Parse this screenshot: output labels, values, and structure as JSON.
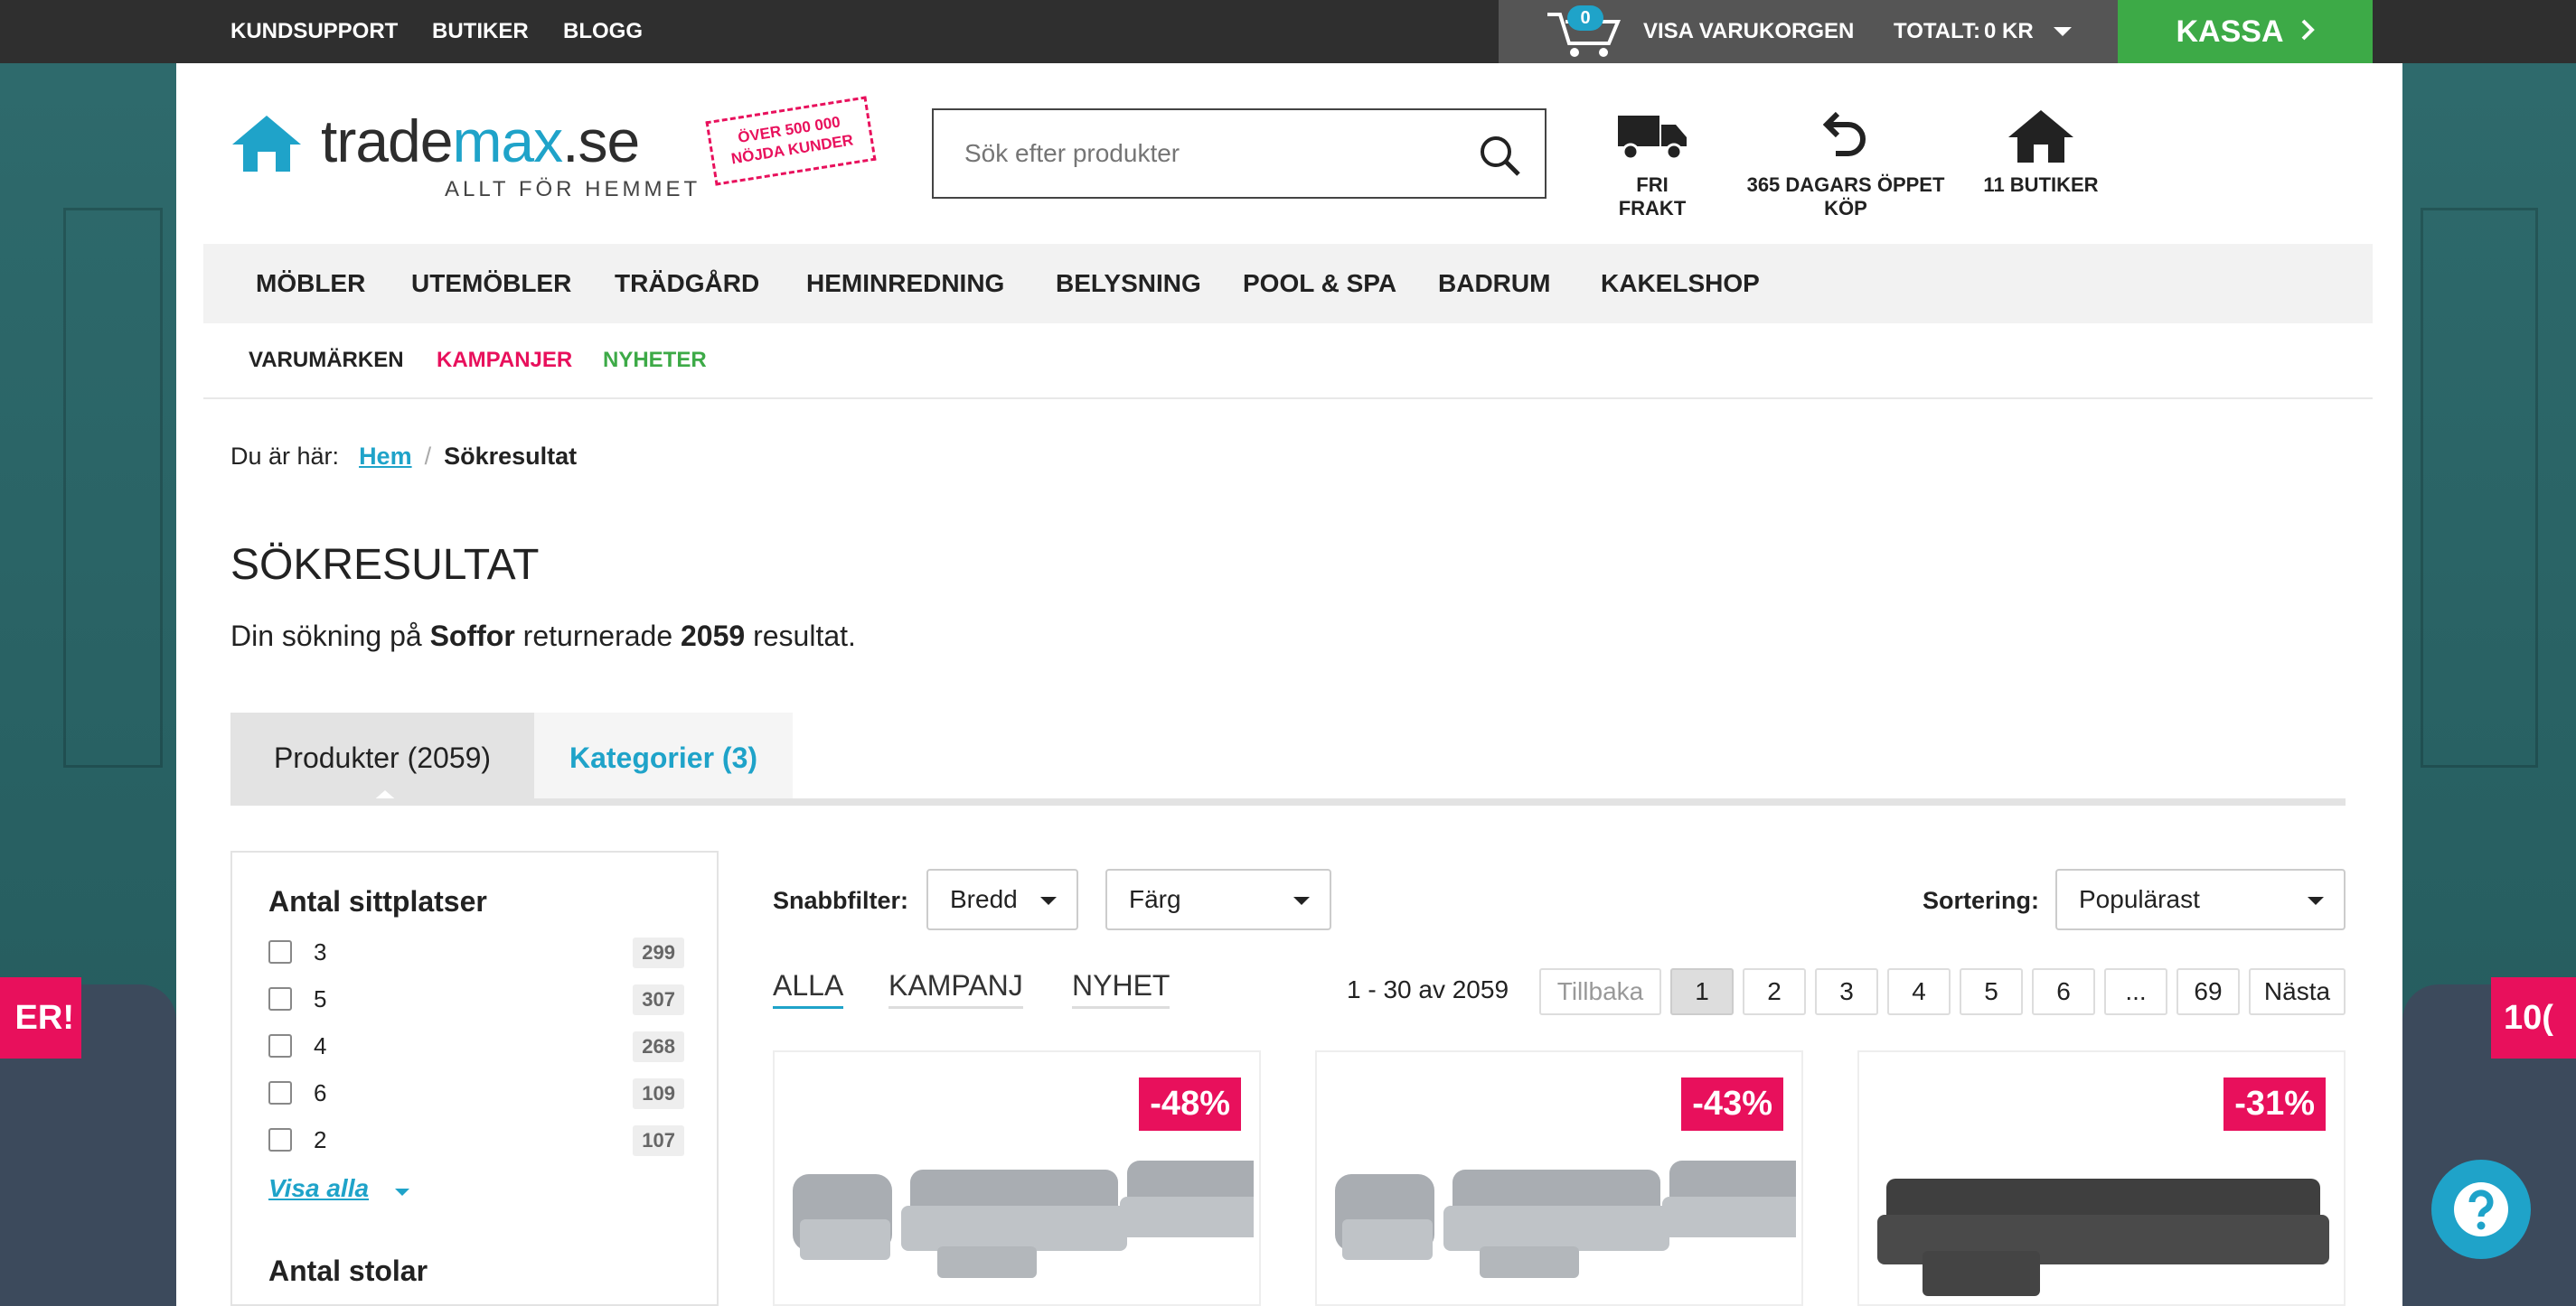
{
  "topbar": {
    "links": [
      "KUNDSUPPORT",
      "BUTIKER",
      "BLOGG"
    ],
    "cart_count": "0",
    "cart_label": "VISA VARUKORGEN",
    "total_label": "TOTALT:",
    "total_value": "0 KR",
    "checkout_label": "KASSA"
  },
  "logo": {
    "name_a": "trade",
    "name_b": "max",
    "name_c": ".se",
    "tagline": "ALLT FÖR HEMMET",
    "stamp_line1": "ÖVER 500 000",
    "stamp_line2": "NÖJDA KUNDER"
  },
  "search": {
    "placeholder": "Sök efter produkter",
    "value": ""
  },
  "usps": [
    "FRI FRAKT",
    "365 DAGARS ÖPPET KÖP",
    "11 BUTIKER"
  ],
  "nav": {
    "items": [
      "MÖBLER",
      "UTEMÖBLER",
      "TRÄDGÅRD",
      "HEMINREDNING",
      "BELYSNING",
      "POOL & SPA",
      "BADRUM",
      "KAKELSHOP"
    ],
    "sub": [
      {
        "label": "VARUMÄRKEN",
        "color": "#222222"
      },
      {
        "label": "KAMPANJER",
        "color": "#e8105c"
      },
      {
        "label": "NYHETER",
        "color": "#3daa47"
      }
    ]
  },
  "breadcrumb": {
    "prefix": "Du är här:",
    "home": "Hem",
    "sep": "/",
    "current": "Sökresultat"
  },
  "results": {
    "title": "SÖKRESULTAT",
    "summary_a": "Din sökning på",
    "query": "Soffor",
    "summary_b": "returnerade",
    "count": "2059",
    "summary_c": "resultat."
  },
  "tabs": {
    "products": "Produkter (2059)",
    "categories": "Kategorier (3)"
  },
  "filters": {
    "group1_title": "Antal sittplatser",
    "options": [
      {
        "label": "3",
        "count": "299"
      },
      {
        "label": "5",
        "count": "307"
      },
      {
        "label": "4",
        "count": "268"
      },
      {
        "label": "6",
        "count": "109"
      },
      {
        "label": "2",
        "count": "107"
      }
    ],
    "show_all": "Visa alla",
    "group2_title": "Antal stolar"
  },
  "toolbar": {
    "quick_filter_label": "Snabbfilter:",
    "width_select": "Bredd",
    "color_select": "Färg",
    "sort_label": "Sortering:",
    "sort_select": "Populärast"
  },
  "filter_tabs": [
    "ALLA",
    "KAMPANJ",
    "NYHET"
  ],
  "pagination": {
    "range": "1 - 30 av 2059",
    "prev": "Tillbaka",
    "pages": [
      "1",
      "2",
      "3",
      "4",
      "5",
      "6",
      "...",
      "69"
    ],
    "next": "Nästa"
  },
  "products": [
    {
      "discount": "-48%"
    },
    {
      "discount": "-43%"
    },
    {
      "discount": "-31%"
    }
  ],
  "side_promos": {
    "left": "ER!",
    "right": "10("
  },
  "colors": {
    "brand_blue": "#1fa3c9",
    "checkout_green": "#3daa47",
    "sale_pink": "#e8105c",
    "topbar": "#2f2f2f"
  }
}
